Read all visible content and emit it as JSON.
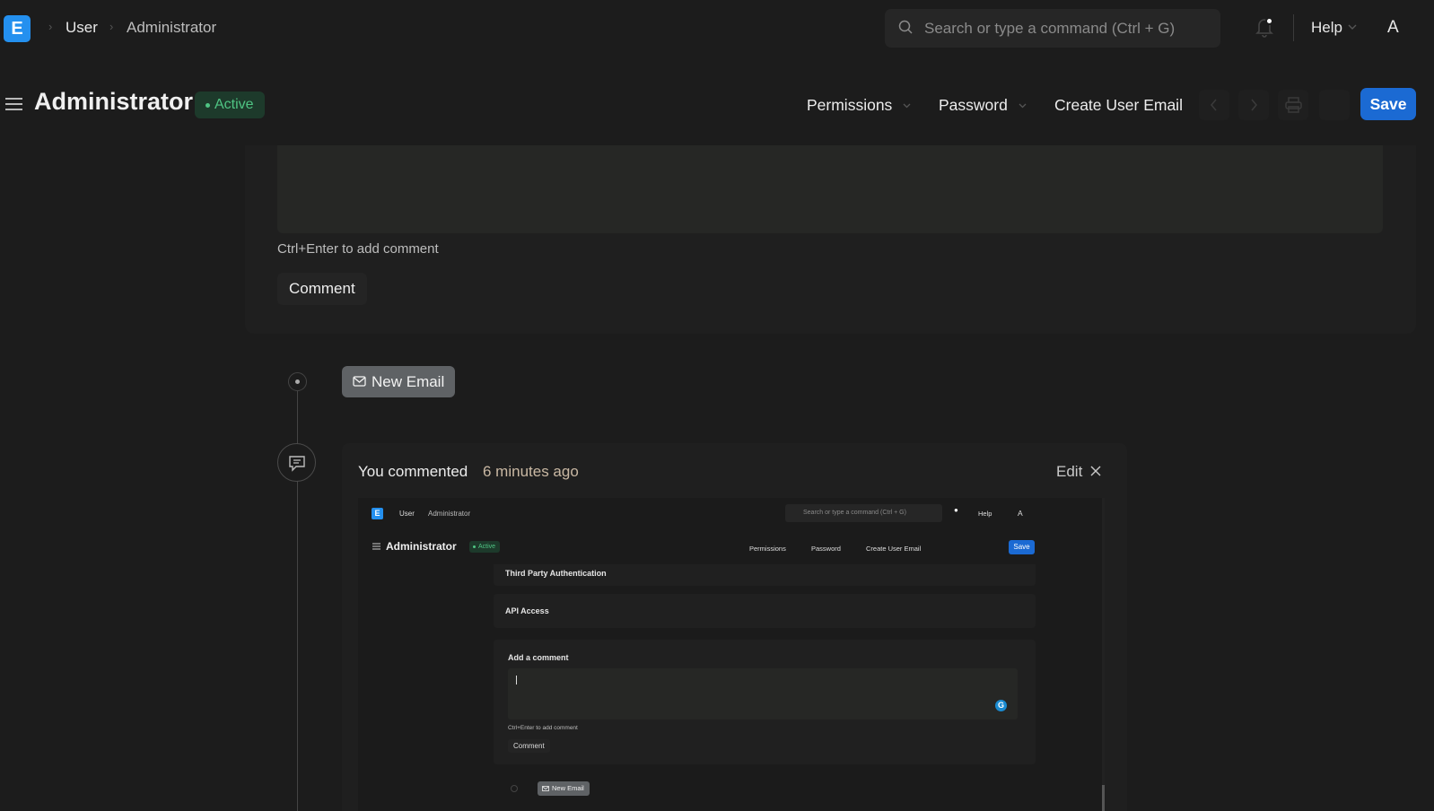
{
  "app": {
    "logo_letter": "E",
    "brand_color": "#2490ef"
  },
  "breadcrumb": {
    "items": [
      "User",
      "Administrator"
    ]
  },
  "search": {
    "placeholder": "Search or type a command (Ctrl + G)"
  },
  "navbar": {
    "help_label": "Help",
    "avatar_letter": "A"
  },
  "page": {
    "title": "Administrator",
    "status": "Active",
    "status_color": "#4fc483"
  },
  "toolbar": {
    "permissions_label": "Permissions",
    "password_label": "Password",
    "create_user_email_label": "Create User Email",
    "save_label": "Save",
    "save_color": "#1b6ad3"
  },
  "comment_form": {
    "hint": "Ctrl+Enter to add comment",
    "button_label": "Comment"
  },
  "timeline": {
    "new_email_label": "New Email",
    "comment": {
      "author": "You commented",
      "time": "6 minutes ago",
      "edit_label": "Edit"
    }
  },
  "embedded_screenshot": {
    "logo_letter": "E",
    "breadcrumb": [
      "User",
      "Administrator"
    ],
    "search_placeholder": "Search or type a command (Ctrl + G)",
    "help_label": "Help",
    "avatar_letter": "A",
    "title": "Administrator",
    "status": "Active",
    "toolbar": [
      "Permissions",
      "Password",
      "Create User Email"
    ],
    "save_label": "Save",
    "sections": [
      "Third Party Authentication",
      "API Access"
    ],
    "add_comment_title": "Add a comment",
    "grammarly_letter": "G",
    "hint": "Ctrl+Enter to add comment",
    "comment_button": "Comment",
    "new_email_label": "New Email"
  }
}
